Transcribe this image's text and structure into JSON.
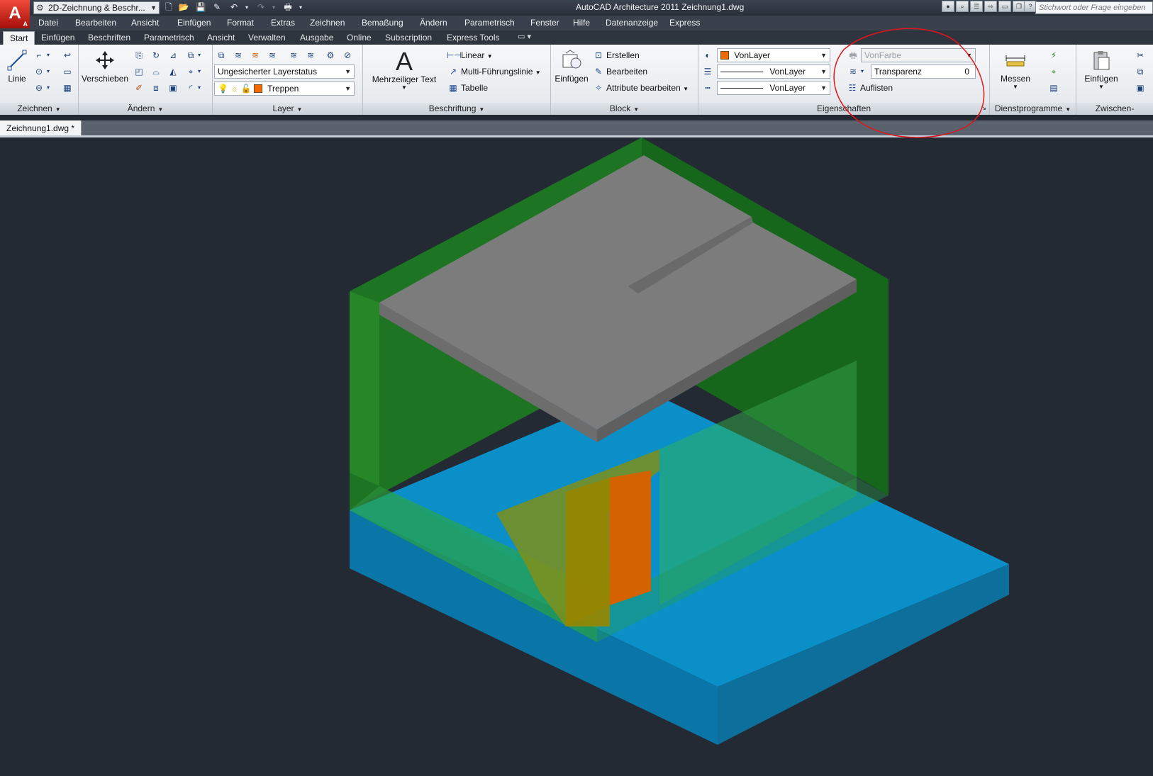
{
  "title_bar": {
    "logo_letter": "A",
    "logo_sub": "A",
    "workspace": "2D-Zeichnung & Beschr...",
    "title": "AutoCAD Architecture 2011    Zeichnung1.dwg",
    "search_placeholder": "Stichwort oder Frage eingeben",
    "quick_access_icons": [
      "new-icon",
      "open-icon",
      "save-icon",
      "save-as-icon",
      "undo-icon",
      "redo-icon",
      "plot-icon"
    ]
  },
  "menu": [
    "Datei",
    "Bearbeiten",
    "Ansicht",
    "Einfügen",
    "Format",
    "Extras",
    "Zeichnen",
    "Bemaßung",
    "Ändern",
    "Parametrisch",
    "Fenster",
    "Hilfe",
    "Datenanzeige",
    "Express"
  ],
  "ribbon_tabs": [
    "Start",
    "Einfügen",
    "Beschriften",
    "Parametrisch",
    "Ansicht",
    "Verwalten",
    "Ausgabe",
    "Online",
    "Subscription",
    "Express Tools"
  ],
  "ribbon_tab_extra": "▭ ▾",
  "panels": {
    "zeichnen": {
      "title": "Zeichnen",
      "line_label": "Linie"
    },
    "aendern": {
      "title": "Ändern",
      "move_label": "Verschieben"
    },
    "layer": {
      "title": "Layer",
      "layer_state": "Ungesicherter Layerstatus",
      "current_layer": "Treppen",
      "layer_color": "#f36b00"
    },
    "beschriftung": {
      "title": "Beschriftung",
      "mtext_label": "Mehrzeiliger Text",
      "mtext_glyph": "A",
      "linear": "Linear",
      "mleader": "Multi-Führungslinie",
      "table": "Tabelle"
    },
    "block": {
      "title": "Block",
      "insert_label": "Einfügen",
      "create": "Erstellen",
      "edit": "Bearbeiten",
      "edit_attr": "Attribute bearbeiten"
    },
    "eigenschaften": {
      "title": "Eigenschaften",
      "color": "VonLayer",
      "color_swatch": "#f36b00",
      "linetype": "VonLayer",
      "lineweight": "VonLayer",
      "plotstyle": "VonFarbe",
      "transparency_label": "Transparenz",
      "transparency_value": "0",
      "list": "Auflisten"
    },
    "dienstprogramme": {
      "title": "Dienstprogramme",
      "measure_label": "Messen"
    },
    "zwischenablage": {
      "title": "Zwischen-",
      "paste_label": "Einfügen"
    }
  },
  "document_tab": "Zeichnung1.dwg *",
  "viewport": {
    "background": "#232a33",
    "colors": {
      "walls": "#2fae2a",
      "slab": "#7c7c7c",
      "stairs": "#d46200",
      "floor": "#0a8fc9"
    }
  }
}
